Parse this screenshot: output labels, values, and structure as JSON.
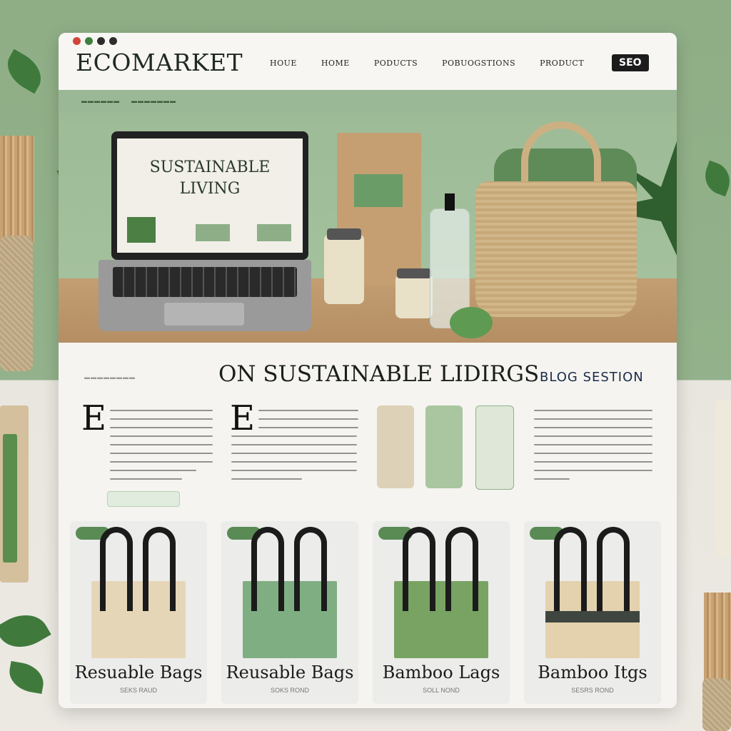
{
  "header": {
    "logo": "ECOMARKET",
    "nav": [
      "HOUE",
      "HOME",
      "PODUCTS",
      "POBUOGSTIONS",
      "PRODUCT"
    ],
    "seo_button": "SEO"
  },
  "hero": {
    "laptop_title_line1": "SUSTAINABLE",
    "laptop_title_line2": "LIVING"
  },
  "blog": {
    "heading": "ON SUSTAINABLE LIDIRGS",
    "section_label": "BLOG SESTION",
    "dropcaps": [
      "E",
      "E"
    ]
  },
  "products": [
    {
      "title": "Resuable Bags",
      "subtitle": "SEKS RAUD"
    },
    {
      "title": "Reusable Bags",
      "subtitle": "SOKS ROND"
    },
    {
      "title": "Bamboo Lags",
      "subtitle": "SOLL NOND"
    },
    {
      "title": "Bamboo Itgs",
      "subtitle": "SESRS ROND"
    }
  ],
  "colors": {
    "brand_green": "#5a8b55",
    "page_bg_green": "#8fae86",
    "text_dark": "#1b1f1c"
  }
}
